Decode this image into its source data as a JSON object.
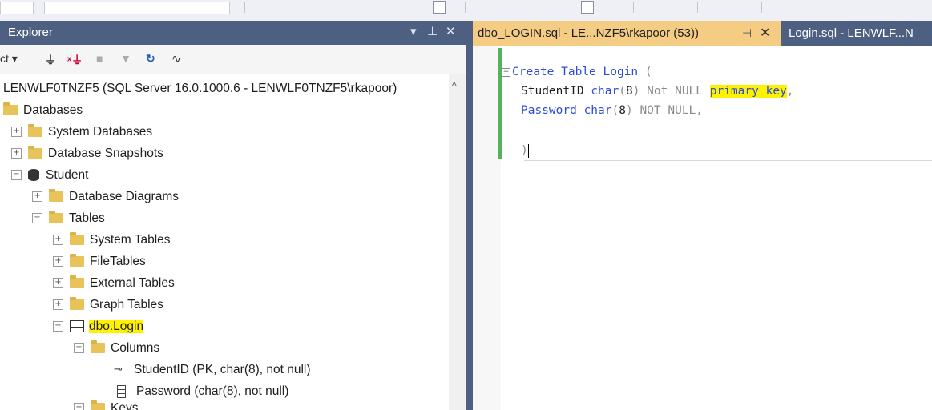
{
  "window": {
    "accent": "#4d6082",
    "active_tab_color": "#f5cc84"
  },
  "object_explorer": {
    "title": "Explorer",
    "header_buttons": [
      "▾",
      "⊥",
      "✕"
    ],
    "toolbar": {
      "connect_label": "ct ▾"
    },
    "tree": {
      "server": "LENWLF0TNZF5 (SQL Server 16.0.1000.6 - LENWLF0TNZF5\\rkapoor)",
      "databases": "Databases",
      "system_databases": "System Databases",
      "database_snapshots": "Database Snapshots",
      "student_db": "Student",
      "database_diagrams": "Database Diagrams",
      "tables": "Tables",
      "system_tables": "System Tables",
      "file_tables": "FileTables",
      "external_tables": "External Tables",
      "graph_tables": "Graph Tables",
      "login_table": "dbo.Login",
      "columns": "Columns",
      "col_studentid": "StudentID (PK, char(8), not null)",
      "col_password": "Password (char(8), not null)",
      "keys": "Keys"
    }
  },
  "editor": {
    "active_tab": "dbo_LOGIN.sql - LE...NZF5\\rkapoor (53))",
    "inactive_tab": "Login.sql - LENWLF...N",
    "code": {
      "l1_kw1": "Create",
      "l1_kw2": "Table",
      "l1_name": "Login",
      "l1_paren": "(",
      "l2_col": "StudentID",
      "l2_type": "char",
      "l2_open": "(",
      "l2_num": "8",
      "l2_close": ")",
      "l2_notnull": "Not NULL",
      "l2_pk": "primary key",
      "l2_comma": ",",
      "l3_col": "Password",
      "l3_type": "char",
      "l3_open": "(",
      "l3_num": "8",
      "l3_close": ")",
      "l3_notnull": "NOT NULL",
      "l3_comma": ",",
      "l5": ")"
    }
  }
}
